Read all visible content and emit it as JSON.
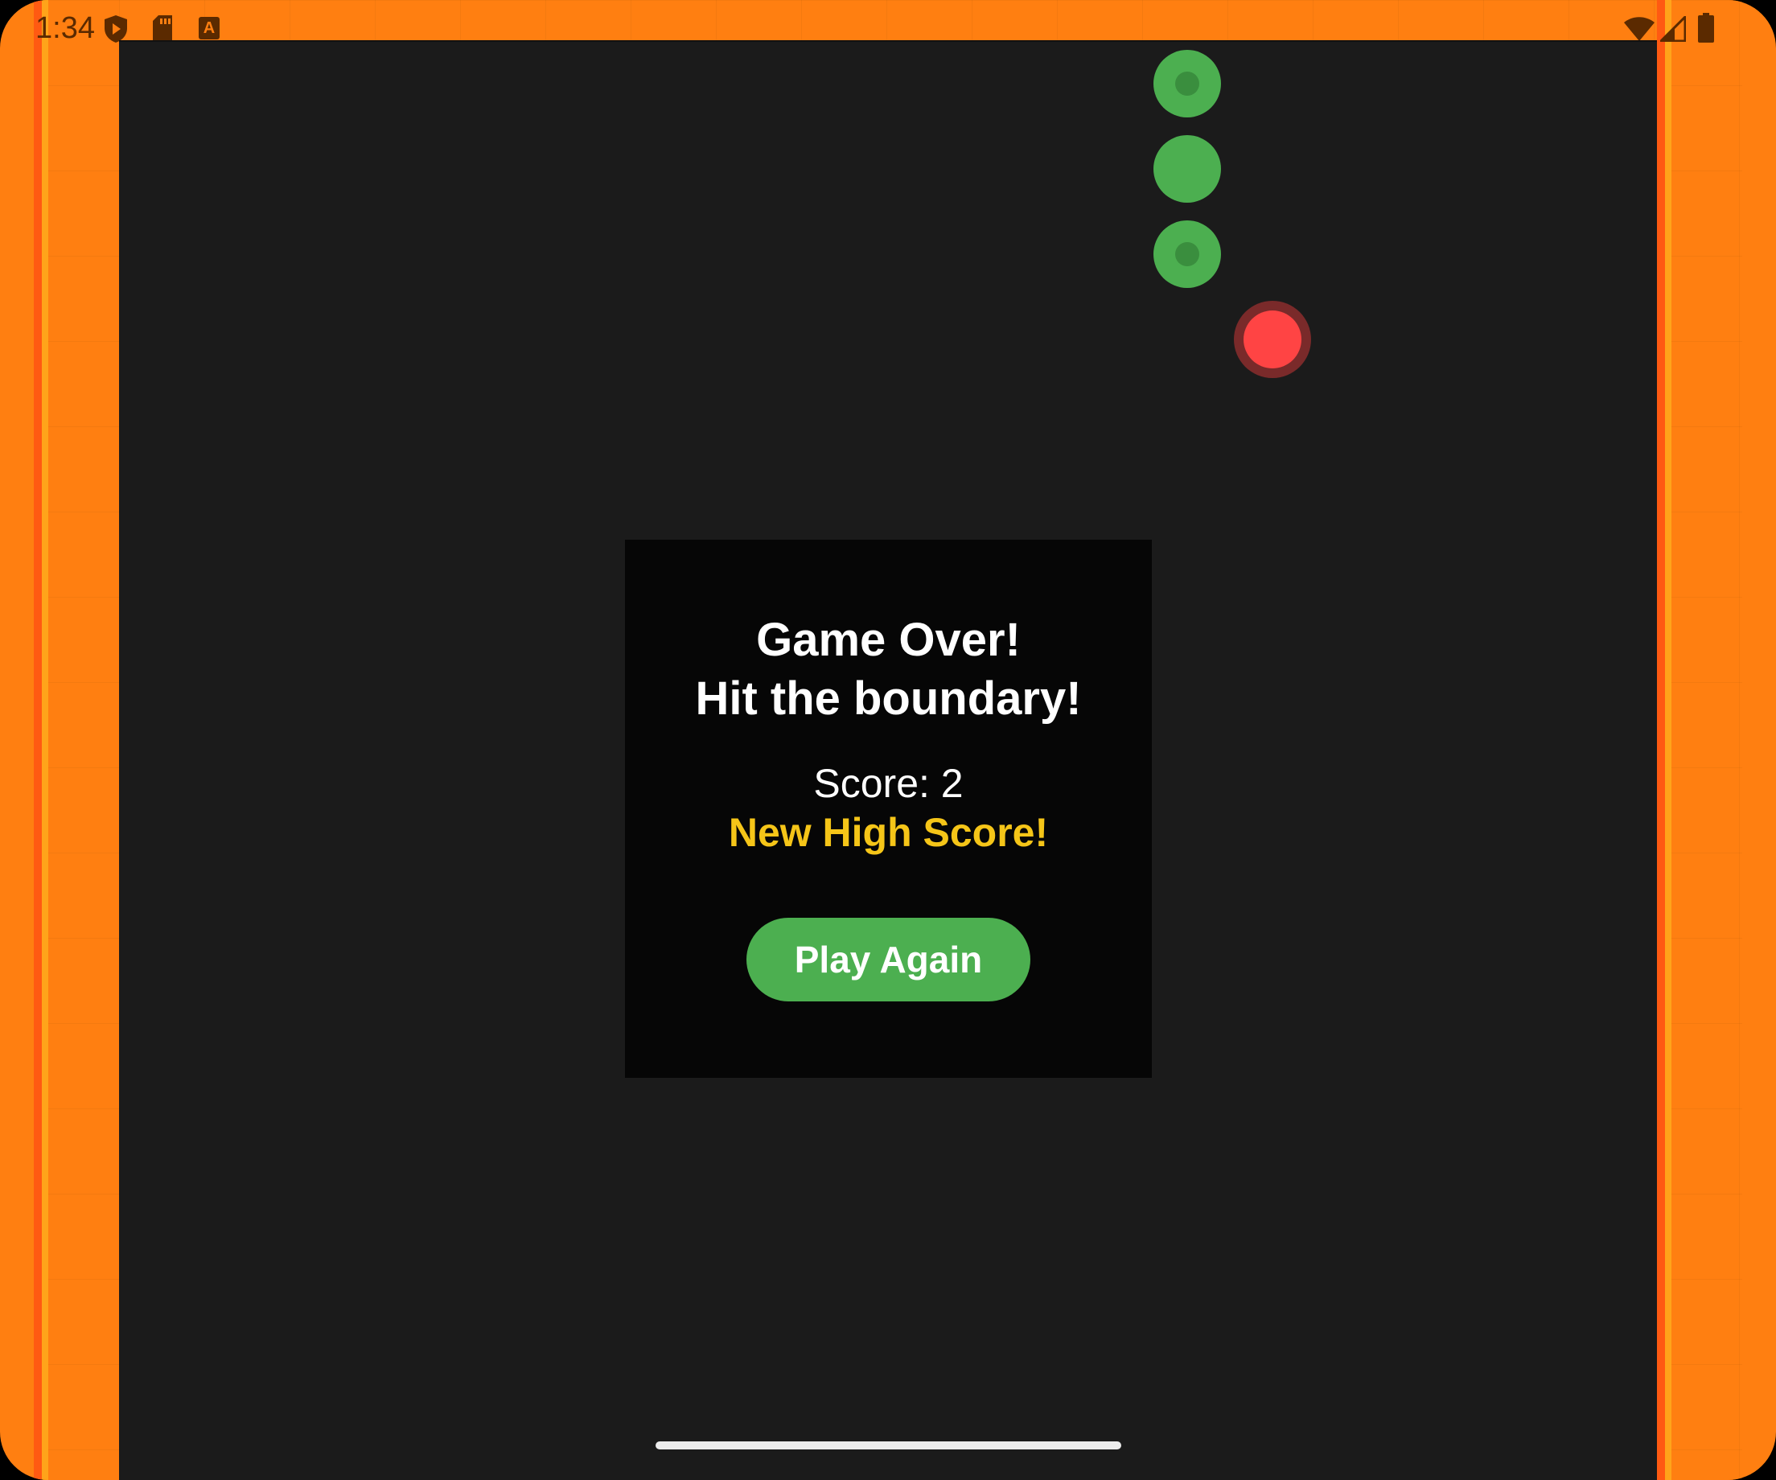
{
  "status_bar": {
    "time": "1:34",
    "icons": [
      "play-protect-icon",
      "sd-card-icon",
      "keyboard-a-icon",
      "wifi-icon",
      "signal-icon",
      "battery-icon"
    ]
  },
  "game": {
    "snake_color": "#4CAF50",
    "food_color": "#FF4444",
    "board_color": "#1B1B1B",
    "border_color": "#FF7F11",
    "snake_segments": 3,
    "food_count": 1
  },
  "dialog": {
    "title_line1": "Game Over!",
    "title_line2": "Hit the boundary!",
    "score_text": "Score: 2",
    "high_score_text": "New High Score!",
    "play_again_label": "Play Again",
    "high_score_color": "#F5C518"
  }
}
